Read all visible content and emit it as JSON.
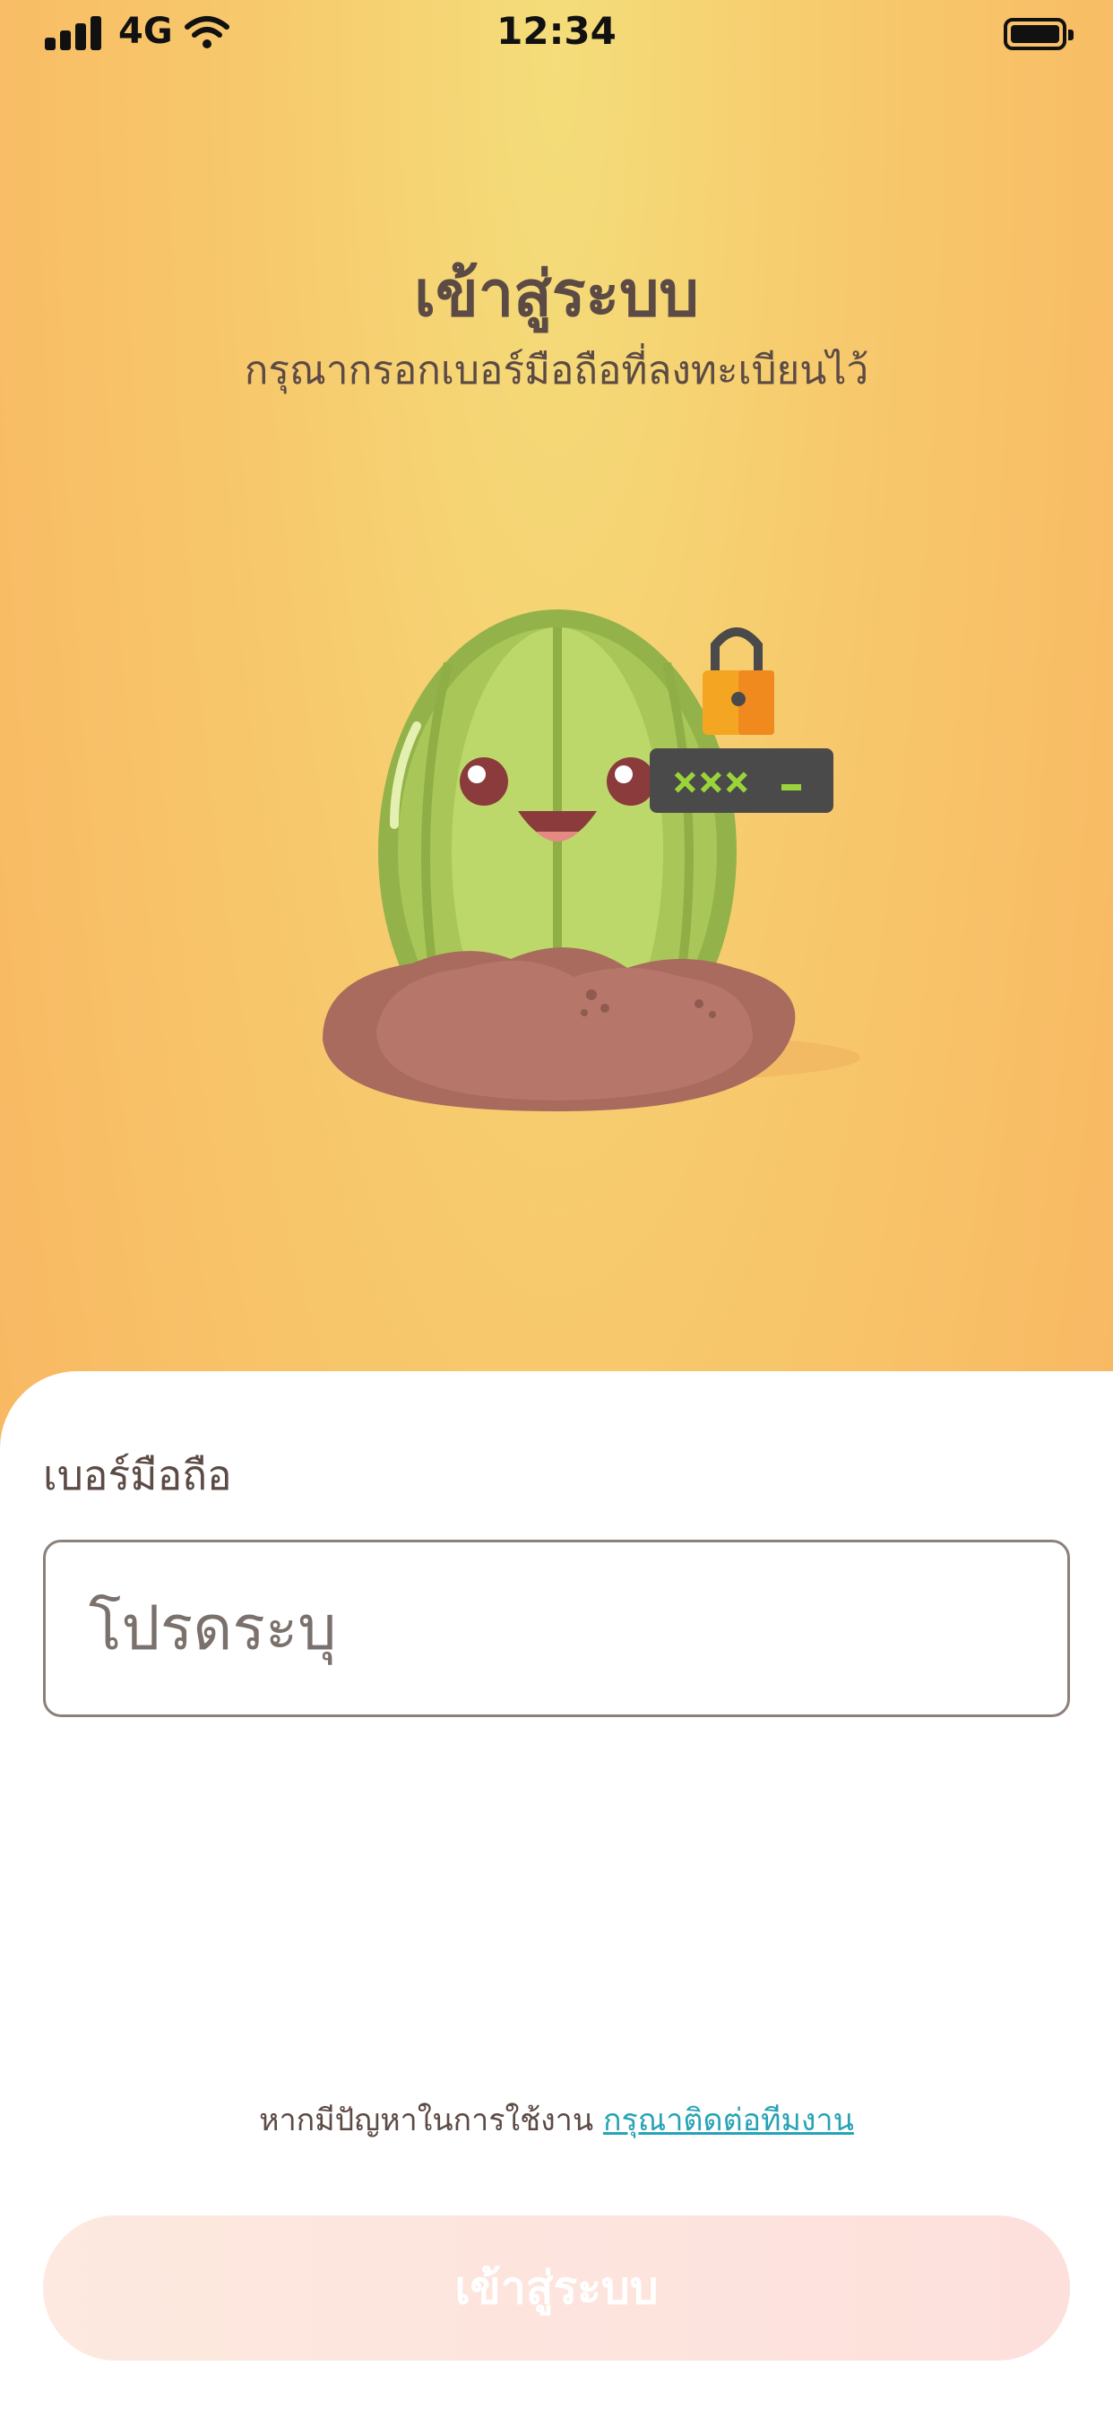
{
  "status_bar": {
    "network": "4G",
    "time": "12:34"
  },
  "header": {
    "title": "เข้าสู่ระบบ",
    "subtitle": "กรุณากรอกเบอร์มือถือที่ลงทะเบียนไว้"
  },
  "illustration": {
    "icon": "melon-mascot-with-lock",
    "password_mask": "***_"
  },
  "form": {
    "phone_label": "เบอร์มือถือ",
    "phone_placeholder": "โปรดระบุ",
    "phone_value": ""
  },
  "help": {
    "text": "หากมีปัญหาในการใช้งาน",
    "link": "กรุณาติดต่อทีมงาน"
  },
  "login_button": {
    "label": "เข้าสู่ระบบ"
  },
  "colors": {
    "accent_link": "#27a3b6",
    "text_primary": "#5c4a45",
    "button_disabled": "#fde4de"
  }
}
